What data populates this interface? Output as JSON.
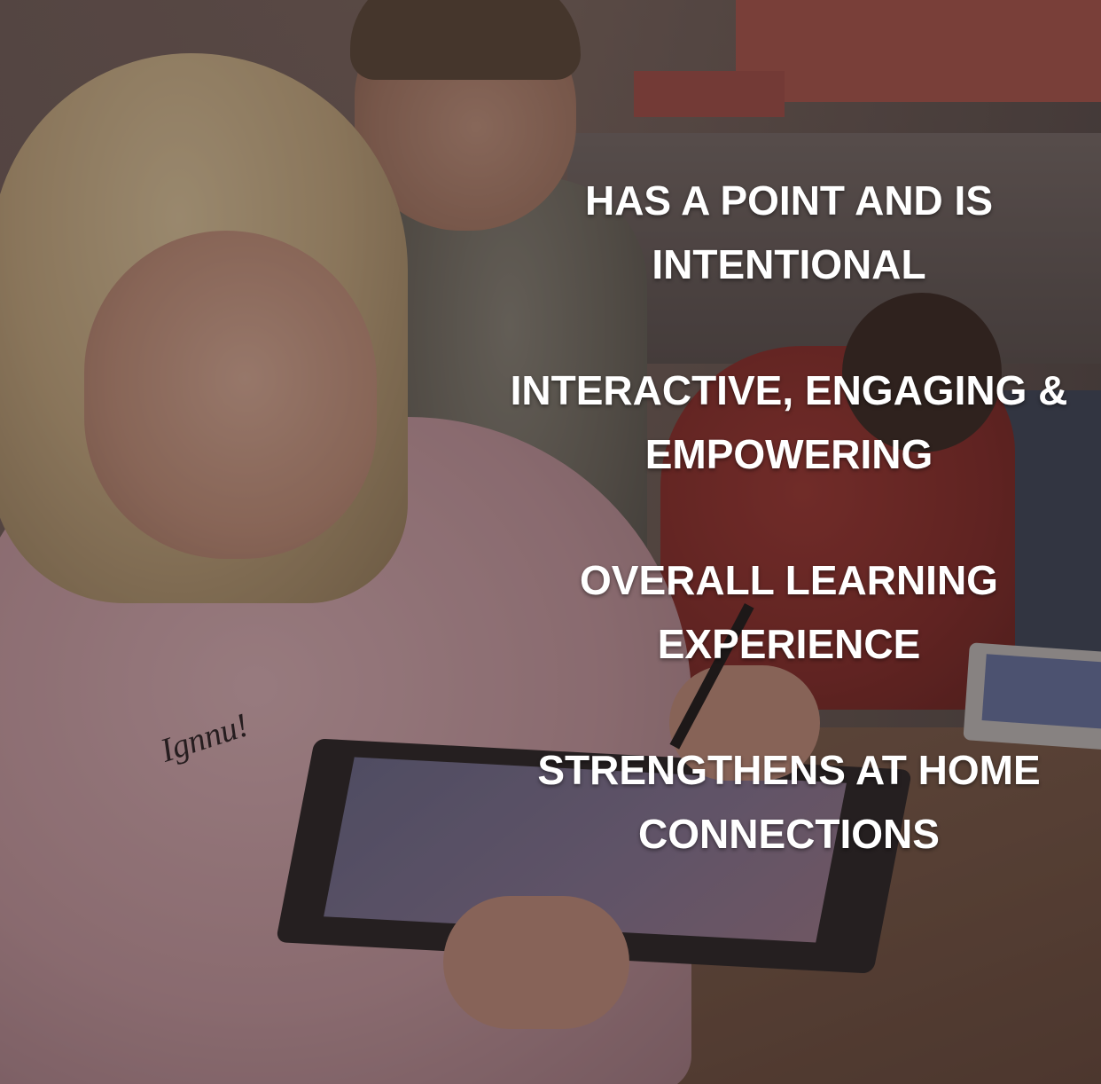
{
  "points": [
    {
      "line1": "HAS A POINT AND IS",
      "line2": "INTENTIONAL"
    },
    {
      "line1": "INTERACTIVE, ENGAGING &",
      "line2": "EMPOWERING"
    },
    {
      "line1": "OVERALL LEARNING",
      "line2": "EXPERIENCE"
    },
    {
      "line1": "STRENGTHENS AT HOME",
      "line2": "CONNECTIONS"
    }
  ],
  "sweater_print": "Ignnu!",
  "colors": {
    "text": "#ffffff",
    "accent_red": "#b25a50",
    "sweater_pink": "#e3b9bf"
  }
}
